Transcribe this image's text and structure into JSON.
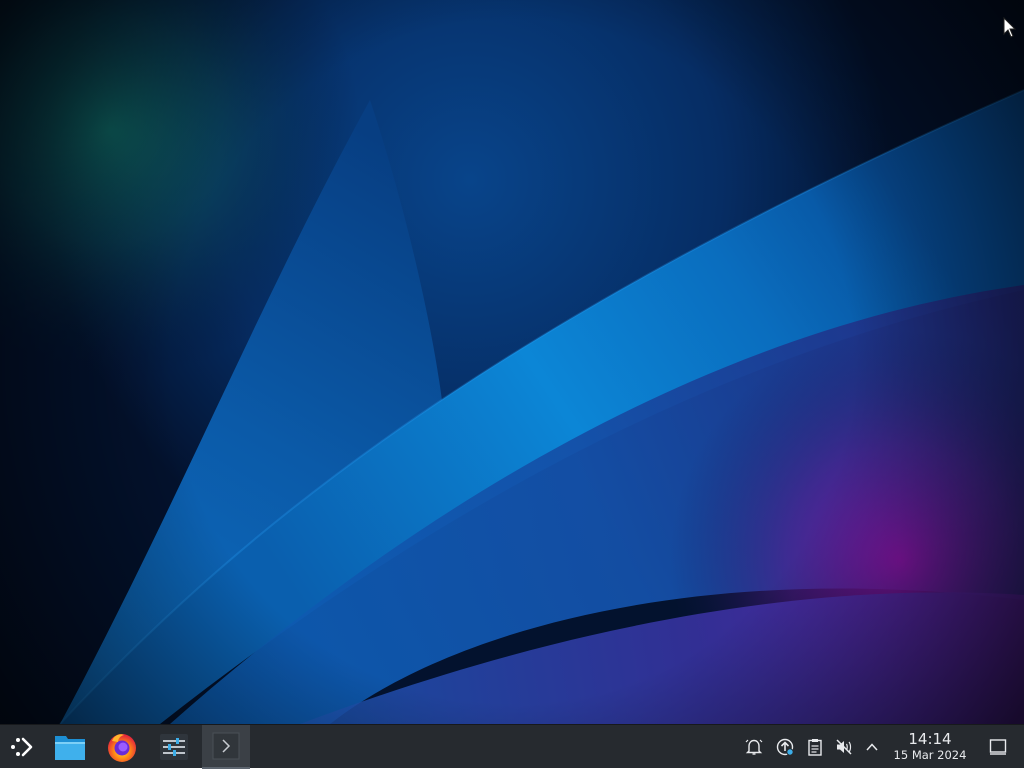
{
  "taskbar": {
    "launcher_icon": "kde-application-launcher-icon",
    "tasks": [
      {
        "name": "Dolphin",
        "icon": "folder-icon",
        "active": false
      },
      {
        "name": "Firefox",
        "icon": "firefox-icon",
        "active": false
      },
      {
        "name": "System Settings",
        "icon": "settings-sliders-icon",
        "active": false
      },
      {
        "name": "Konsole",
        "icon": "terminal-icon",
        "active": true
      }
    ],
    "tray": {
      "icons": [
        "notifications-bell-icon",
        "update-icon",
        "clipboard-icon",
        "volume-muted-icon",
        "expand-tray-arrow-icon"
      ],
      "clock": {
        "time": "14:14",
        "date": "15 Mar 2024"
      },
      "show_desktop_icon": "show-desktop-icon"
    }
  },
  "colors": {
    "panel": "#262a2f",
    "active_task": "#3b4046",
    "text": "#e8eaed",
    "wallpaper_blue": "#0a6ec0",
    "wallpaper_purple": "#8c13a8",
    "wallpaper_teal": "#0f6a66"
  }
}
